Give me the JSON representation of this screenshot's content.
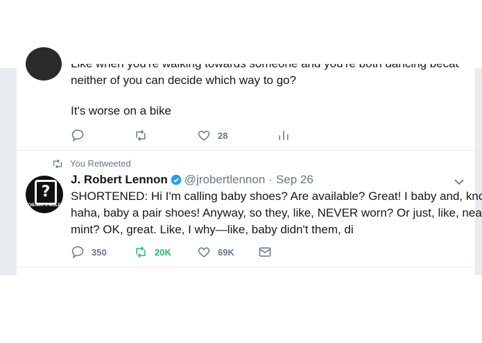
{
  "tweet1": {
    "cut_text": "Like when you're walking towards someone and you're both dancing because",
    "line1": "neither of you can decide which way to go?",
    "line2": "It's worse on a bike",
    "actions": {
      "like_count": "28"
    }
  },
  "tweet2": {
    "retweet_context": "You Retweeted",
    "author_name": "J. Robert Lennon",
    "handle": "@jrobertlennon",
    "separator": "·",
    "date": "Sep 26",
    "avatar_caption": "OBAMA'S MOLE",
    "lines": [
      "SHORTENED: Hi I'm calling baby shoes? Are available? Great! I baby and, know,",
      "haha, baby a pair shoes! Anyway, so they, like, NEVER worn? Or just, like, near",
      "mint? OK, great. Like, I why—like, baby didn't them, di"
    ],
    "actions": {
      "reply_count": "350",
      "retweet_count": "20K",
      "like_count": "69K"
    }
  },
  "colors": {
    "text": "#14171a",
    "muted": "#657786",
    "retweet_active": "#17bf63",
    "verified": "#1da1f2",
    "background": "#e6ecf0"
  }
}
